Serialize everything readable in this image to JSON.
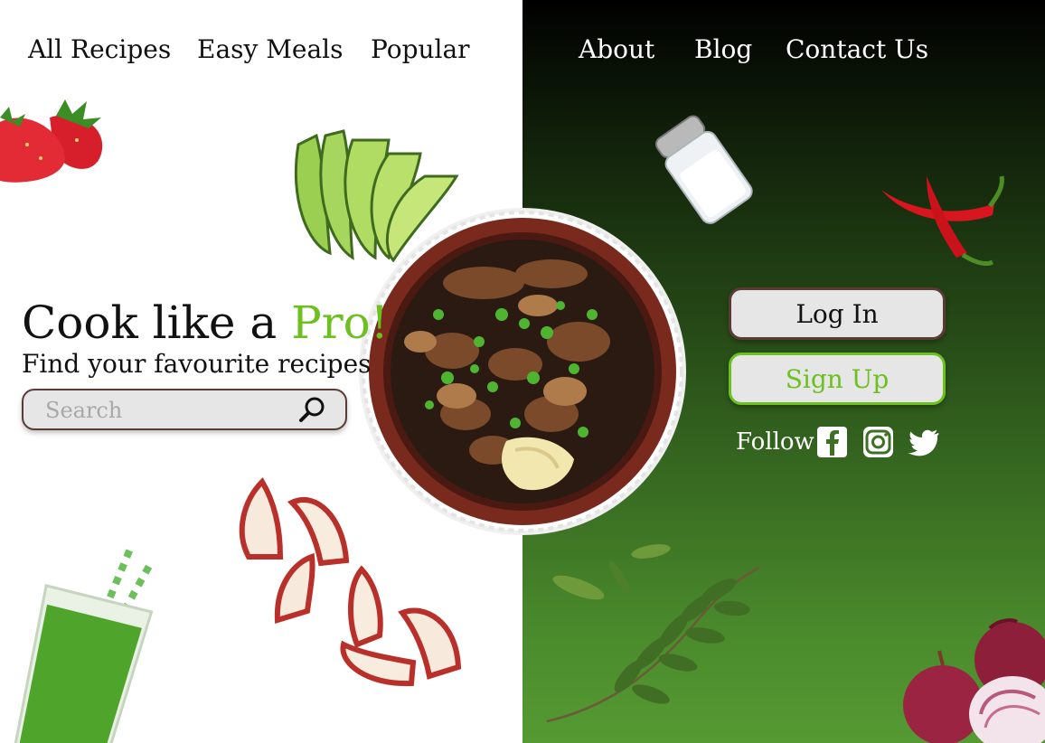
{
  "nav": {
    "items": [
      "All Recipes",
      "Easy Meals",
      "Popular",
      "About",
      "Blog",
      "Contact Us"
    ]
  },
  "hero": {
    "headline_main": "Cook like a ",
    "headline_accent": "Pro!",
    "subheadline": "Find your favourite recipes"
  },
  "search": {
    "placeholder": "Search",
    "icon": "search-icon"
  },
  "auth": {
    "login_label": "Log In",
    "signup_label": "Sign Up"
  },
  "social": {
    "follow_label": "Follow",
    "icons": [
      "facebook-icon",
      "instagram-icon",
      "twitter-icon"
    ]
  },
  "colors": {
    "accent_green": "#6cc01f",
    "button_border_brown": "#5a3b36",
    "button_fill": "#e6e6e6",
    "dark_panel_top": "#000000",
    "dark_panel_bottom": "#559a33"
  }
}
